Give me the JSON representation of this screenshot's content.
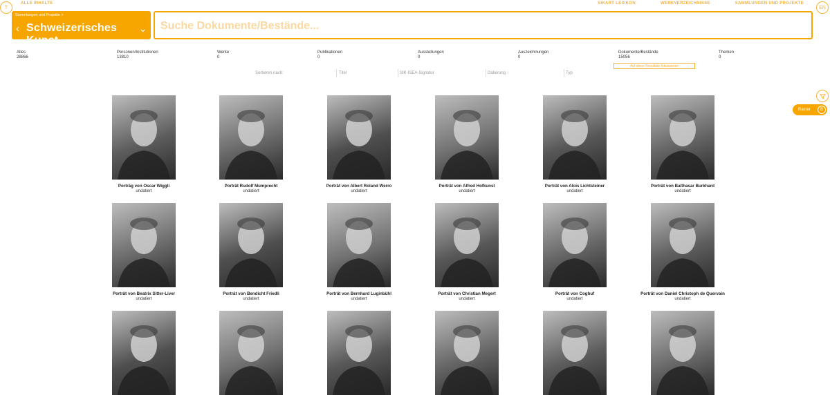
{
  "header": {
    "left_icon": "T",
    "all_contents_link": "ALLE INHALTE",
    "nav": [
      "SIKART LEXIKON",
      "WERKVERZEICHNISSE",
      "SAMMLUNGEN UND PROJEKTE"
    ],
    "right_icon": "EN"
  },
  "collection": {
    "breadcrumb": "Sammlungen und Projekte >",
    "title": "Schweizerisches Kunst..."
  },
  "search": {
    "placeholder": "Suche Dokumente/Bestände...",
    "value": ""
  },
  "categories": [
    {
      "label": "Alles",
      "count": "28866"
    },
    {
      "label": "Personen/Institutionen",
      "count": "13810"
    },
    {
      "label": "Werke",
      "count": "0"
    },
    {
      "label": "Publikationen",
      "count": "0"
    },
    {
      "label": "Ausstellungen",
      "count": "0"
    },
    {
      "label": "Auszeichnungen",
      "count": "0"
    },
    {
      "label": "Dokumente/Bestände",
      "count": "15056"
    },
    {
      "label": "Themen",
      "count": "0"
    }
  ],
  "refine_label": "Auf diese Resultate fokussieren",
  "sort": {
    "label": "Sortieren nach:",
    "options": [
      "Titel",
      "SIK-ISEA-Signatur",
      "Datierung ↑",
      "Typ"
    ]
  },
  "side": {
    "filter_icon": "funnel-icon",
    "view_label": "Raster",
    "view_icon": "B"
  },
  "results": [
    {
      "caption": "Porträg von Oscar Wiggli",
      "date": "undatiert"
    },
    {
      "caption": "Porträt Rudolf Mumprecht",
      "date": "undatiert"
    },
    {
      "caption": "Porträt von Albert Roland Werro",
      "date": "undatiert"
    },
    {
      "caption": "Porträt von Alfred Hofkunst",
      "date": "undatiert"
    },
    {
      "caption": "Porträt von Alois Lichtsteiner",
      "date": "undatiert"
    },
    {
      "caption": "Porträt von Balthasar Burkhard",
      "date": "undatiert"
    },
    {
      "caption": "Porträt von Beatrix Sitter-Liver",
      "date": "undatiert"
    },
    {
      "caption": "Porträt von Bendicht Friedli",
      "date": "undatiert"
    },
    {
      "caption": "Porträt von Bernhard Luginbühl",
      "date": "undatiert"
    },
    {
      "caption": "Porträt von Christian Megert",
      "date": "undatiert"
    },
    {
      "caption": "Porträt von Coghuf",
      "date": "undatiert"
    },
    {
      "caption": "Porträt von Daniel Christoph de Quervain",
      "date": "undatiert"
    },
    {
      "caption": "",
      "date": ""
    },
    {
      "caption": "",
      "date": ""
    },
    {
      "caption": "",
      "date": ""
    },
    {
      "caption": "",
      "date": ""
    },
    {
      "caption": "",
      "date": ""
    },
    {
      "caption": "",
      "date": ""
    }
  ]
}
